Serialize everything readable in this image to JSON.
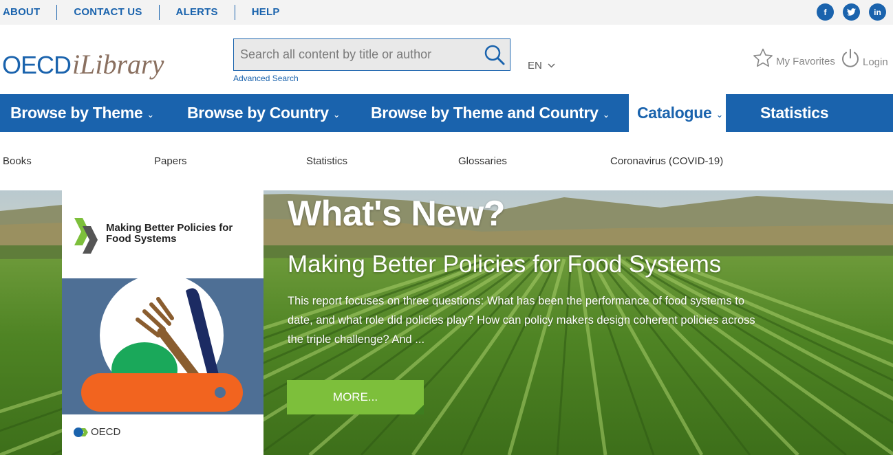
{
  "topbar": {
    "links": [
      "ABOUT",
      "CONTACT US",
      "ALERTS",
      "HELP"
    ],
    "social": [
      {
        "icon": "facebook-icon",
        "glyph": "f"
      },
      {
        "icon": "twitter-icon",
        "glyph": "t"
      },
      {
        "icon": "linkedin-icon",
        "glyph": "in"
      }
    ]
  },
  "header": {
    "logo_oecd": "OECD",
    "logo_ilibrary": "iLibrary",
    "search_placeholder": "Search all content by title or author",
    "advanced_search": "Advanced Search",
    "language": "EN",
    "favorites": "My Favorites",
    "login": "Login"
  },
  "nav": {
    "items": [
      {
        "label": "Browse by Theme",
        "chevron": "⌄"
      },
      {
        "label": "Browse by Country",
        "chevron": "⌄"
      },
      {
        "label": "Browse by Theme and Country",
        "chevron": "⌄"
      },
      {
        "label": "Catalogue",
        "chevron": "⌄"
      },
      {
        "label": "Statistics"
      }
    ]
  },
  "subnav": {
    "items": [
      "Books",
      "Papers",
      "Statistics",
      "Glossaries",
      "Coronavirus (COVID-19)"
    ]
  },
  "hero": {
    "heading": "What's New?",
    "title": "Making Better Policies for Food Systems",
    "description": "This report focuses on three questions: What has been the performance of food systems to date, and what role did policies play? How can policy makers design coherent policies across the triple challenge? And ...",
    "more": "MORE...",
    "cover_title": "Making Better Policies for Food Systems",
    "cover_publisher": "OECD"
  },
  "colors": {
    "brand_blue": "#1a63ad",
    "more_green": "#7dbf3b"
  }
}
